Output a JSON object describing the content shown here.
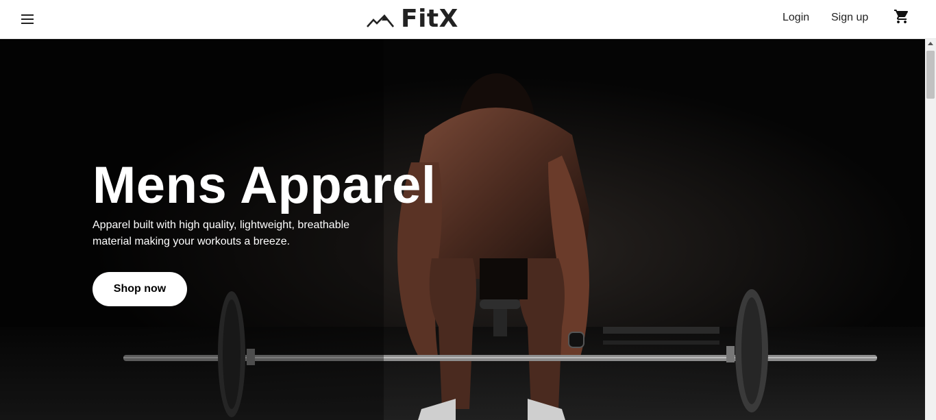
{
  "brand": {
    "name": "FitX",
    "logo_icon": "mountain-peaks-icon"
  },
  "nav": {
    "menu_icon": "hamburger-menu-icon",
    "login_label": "Login",
    "signup_label": "Sign up",
    "cart_icon": "shopping-cart-icon"
  },
  "hero": {
    "title": "Mens Apparel",
    "subtitle": "Apparel built with high quality, lightweight, breathable material making your workouts a breeze.",
    "cta_label": "Shop now",
    "image": "man-deadlifting-barbell-photo"
  },
  "colors": {
    "hero_bg": "#050505",
    "text_light": "#ffffff",
    "nav_bg": "#ffffff",
    "text_dark": "#222222"
  }
}
